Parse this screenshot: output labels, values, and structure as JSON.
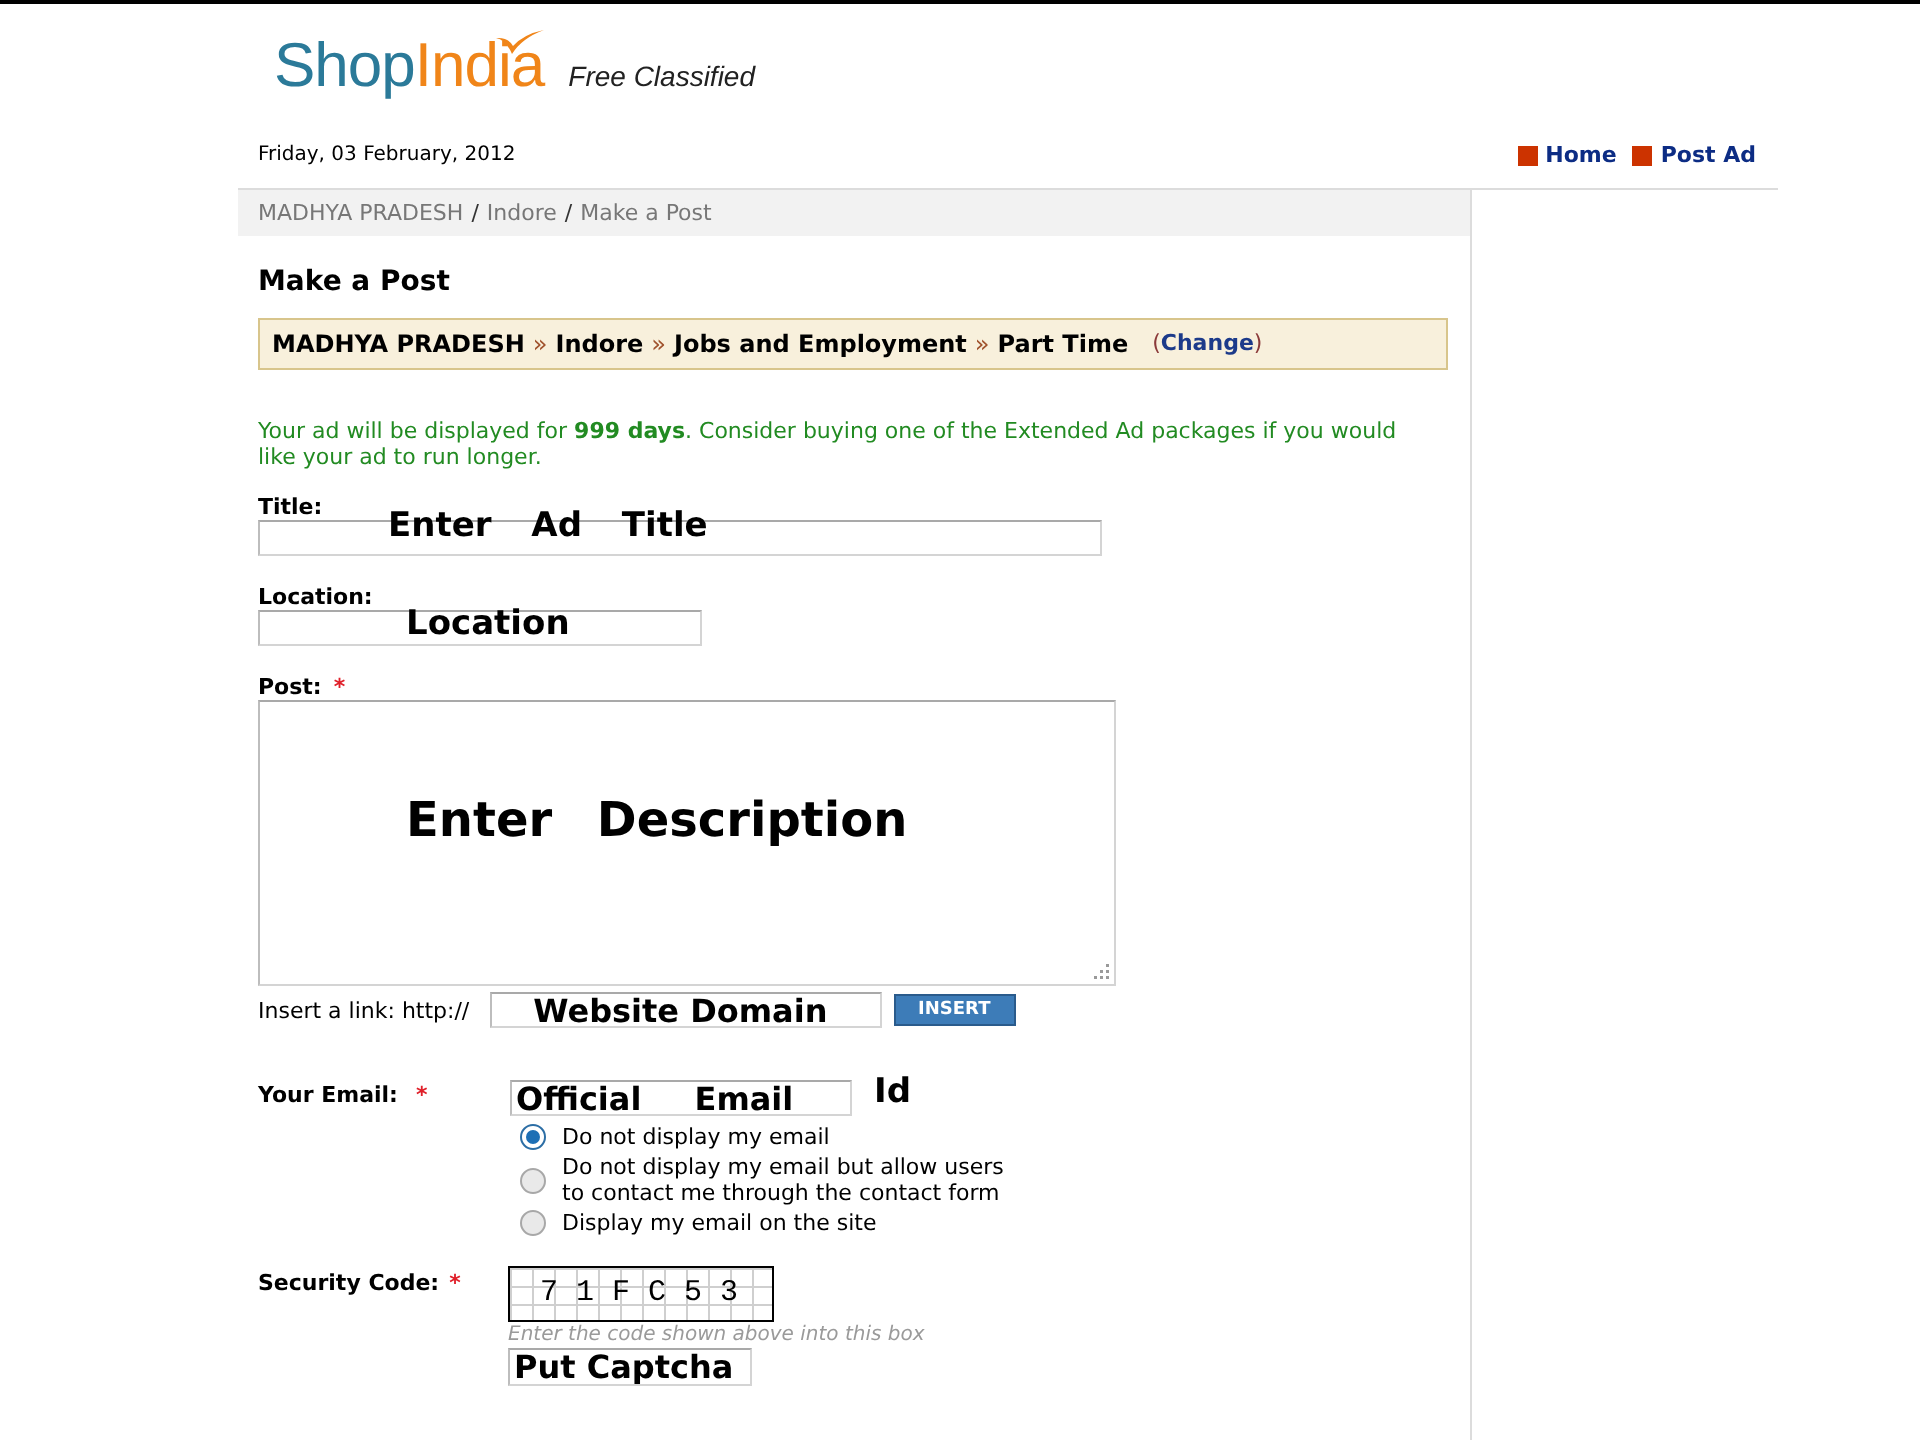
{
  "header": {
    "logo": {
      "part_1": "Shop",
      "part_2": "India"
    },
    "tagline": "Free Classified",
    "date": "Friday, 03 February, 2012",
    "nav_links": [
      "Home",
      "Post Ad"
    ]
  },
  "breadcrumb": {
    "items": [
      "MADHYA PRADESH",
      "Indore",
      "Make a Post"
    ],
    "separator": "/"
  },
  "page_title": "Make a Post",
  "category_path": {
    "items": [
      "MADHYA PRADESH",
      "Indore",
      "Jobs and Employment",
      "Part Time"
    ],
    "separator": "»",
    "change_link": {
      "before": "(",
      "label": "Change",
      "after": ")"
    }
  },
  "notice": "Your ad will be displayed for **999 days**. Consider buying one of the Extended Ad packages if you would like your ad to run longer.",
  "required_mark": "*",
  "fields": [
    {
      "kind": "text",
      "label": "Title:",
      "required": false,
      "annotation": "Enter Ad Title"
    },
    {
      "kind": "text",
      "label": "Location:",
      "required": false,
      "annotation": "Location"
    },
    {
      "kind": "textarea",
      "label": "Post:",
      "required": true,
      "annotation": "Enter Description"
    }
  ],
  "link_insert": {
    "label": "Insert a link: http://",
    "value": "Website Domain",
    "button": "INSERT"
  },
  "email": {
    "label": "Your Email:",
    "required": true,
    "value": "Official Email",
    "value_tail": "Id",
    "options": [
      {
        "label": "Do not display my email",
        "selected": true
      },
      {
        "label": "Do not display my email but allow users to contact me through the contact form",
        "selected": false
      },
      {
        "label": "Display my email on the site",
        "selected": false
      }
    ]
  },
  "security_code": {
    "label": "Security Code:",
    "required": true,
    "captcha": "7 1 F C 5 3",
    "hint": "Enter the code shown above into this box",
    "value": "Put Captcha"
  }
}
